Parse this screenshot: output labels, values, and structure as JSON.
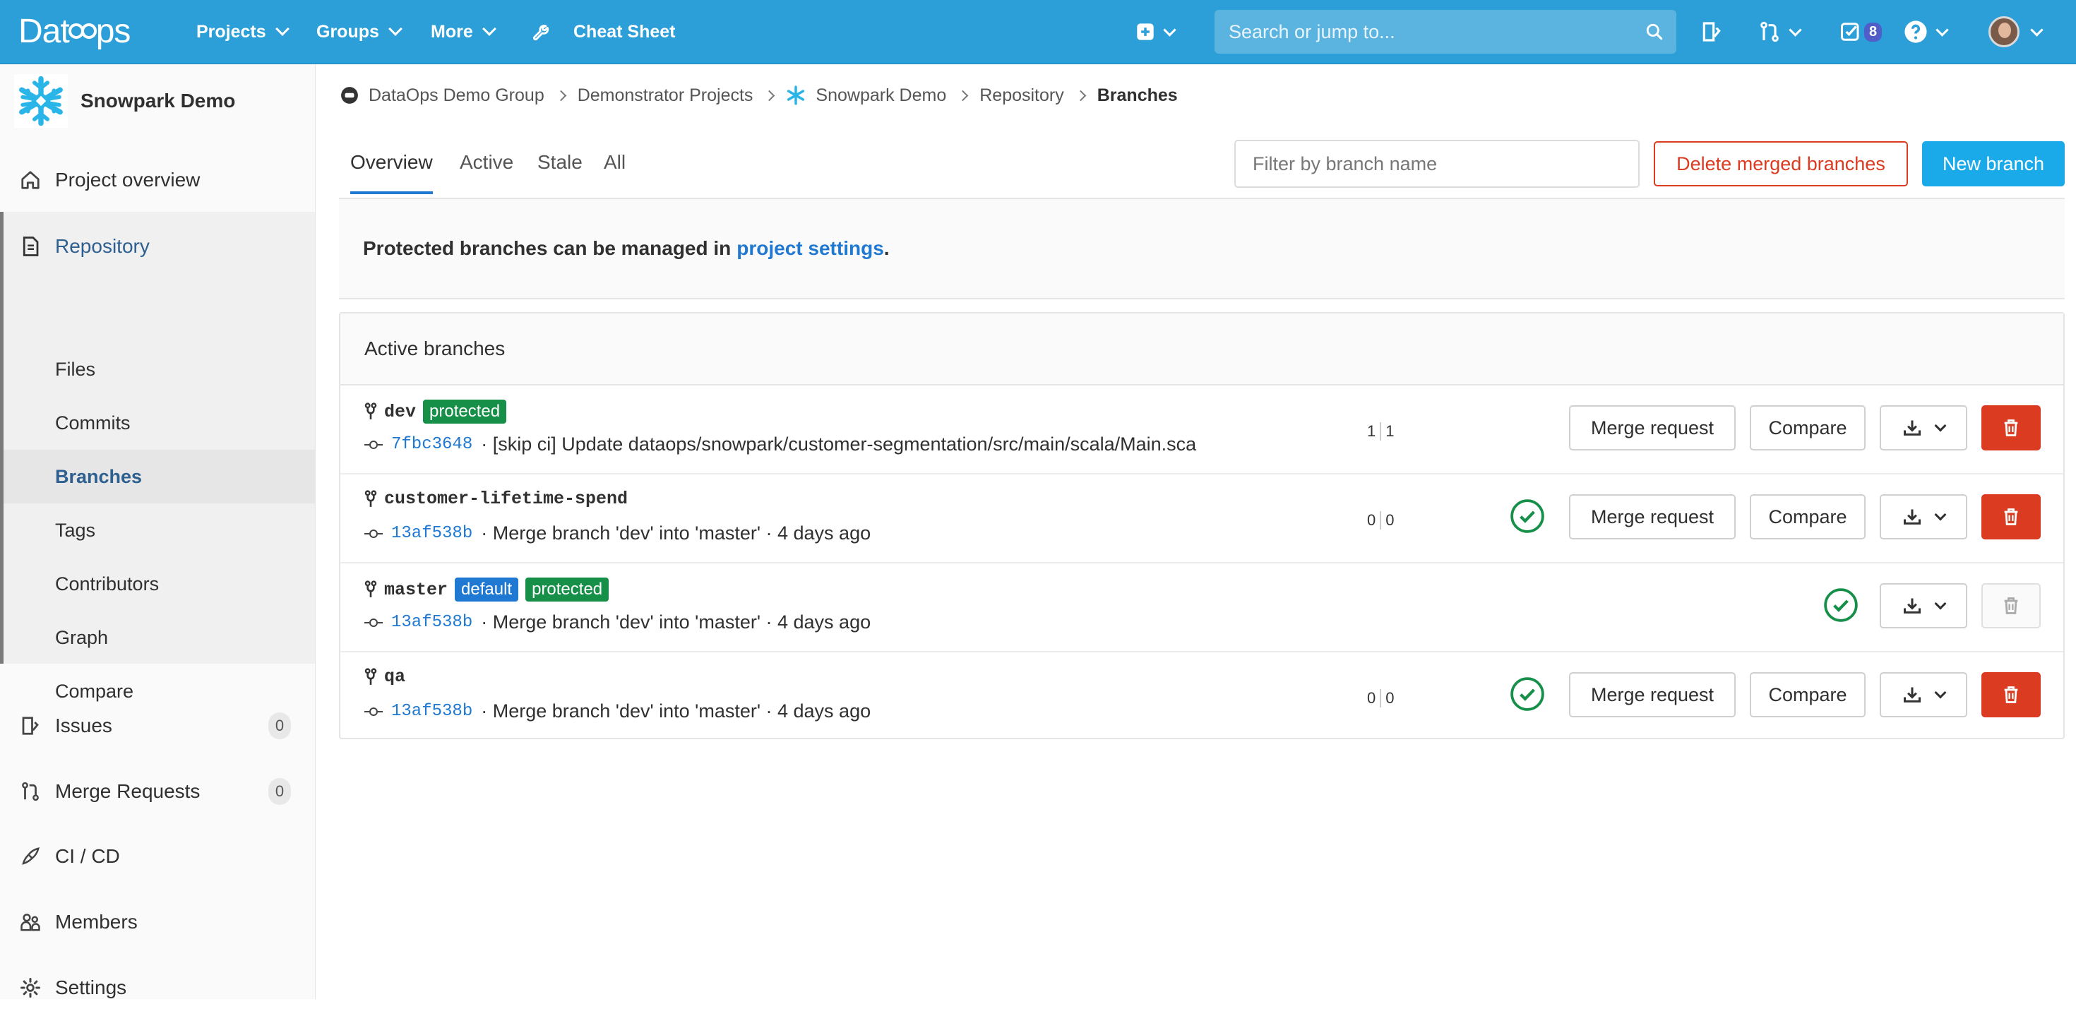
{
  "brand": {
    "pre": "Dat",
    "post": "ps"
  },
  "nav": {
    "projects": "Projects",
    "groups": "Groups",
    "more": "More",
    "cheat_sheet": "Cheat Sheet"
  },
  "search": {
    "placeholder": "Search or jump to..."
  },
  "todos_count": "8",
  "sidebar": {
    "project_name": "Snowpark Demo",
    "overview": "Project overview",
    "repository": "Repository",
    "repo_items": [
      "Files",
      "Commits",
      "Branches",
      "Tags",
      "Contributors",
      "Graph",
      "Compare"
    ],
    "issues": "Issues",
    "issues_count": "0",
    "merge_requests": "Merge Requests",
    "merge_requests_count": "0",
    "cicd": "CI / CD",
    "members": "Members",
    "settings": "Settings"
  },
  "breadcrumb": [
    "DataOps Demo Group",
    "Demonstrator Projects",
    "Snowpark Demo",
    "Repository",
    "Branches"
  ],
  "tabs": [
    "Overview",
    "Active",
    "Stale",
    "All"
  ],
  "filter": {
    "placeholder": "Filter by branch name"
  },
  "buttons": {
    "delete_merged": "Delete merged branches",
    "new_branch": "New branch",
    "merge_request": "Merge request",
    "compare": "Compare"
  },
  "notice": {
    "text": "Protected branches can be managed in",
    "link": "project settings",
    "end": "."
  },
  "panel_title": "Active branches",
  "branches": [
    {
      "name": "dev",
      "labels": [
        "protected"
      ],
      "sha": "7fbc3648",
      "message": "· [skip ci] Update dataops/snowpark/customer-segmentation/src/main/scala/Main.sca",
      "behind": "1",
      "ahead": "1",
      "status": "",
      "deletable": true,
      "mr": true
    },
    {
      "name": "customer-lifetime-spend",
      "labels": [],
      "sha": "13af538b",
      "message": "· Merge branch 'dev' into 'master' · 4 days ago",
      "behind": "0",
      "ahead": "0",
      "status": "passed",
      "deletable": true,
      "mr": true
    },
    {
      "name": "master",
      "labels": [
        "default",
        "protected"
      ],
      "sha": "13af538b",
      "message": "· Merge branch 'dev' into 'master' · 4 days ago",
      "behind": "",
      "ahead": "",
      "status": "passed",
      "deletable": false,
      "mr": false
    },
    {
      "name": "qa",
      "labels": [],
      "sha": "13af538b",
      "message": "· Merge branch 'dev' into 'master' · 4 days ago",
      "behind": "0",
      "ahead": "0",
      "status": "passed",
      "deletable": true,
      "mr": true
    }
  ],
  "colors": {
    "navbar": "#2d9fd8",
    "danger": "#db3b21",
    "success": "#168f48",
    "link": "#1f78d1",
    "primary": "#1aaaea"
  }
}
